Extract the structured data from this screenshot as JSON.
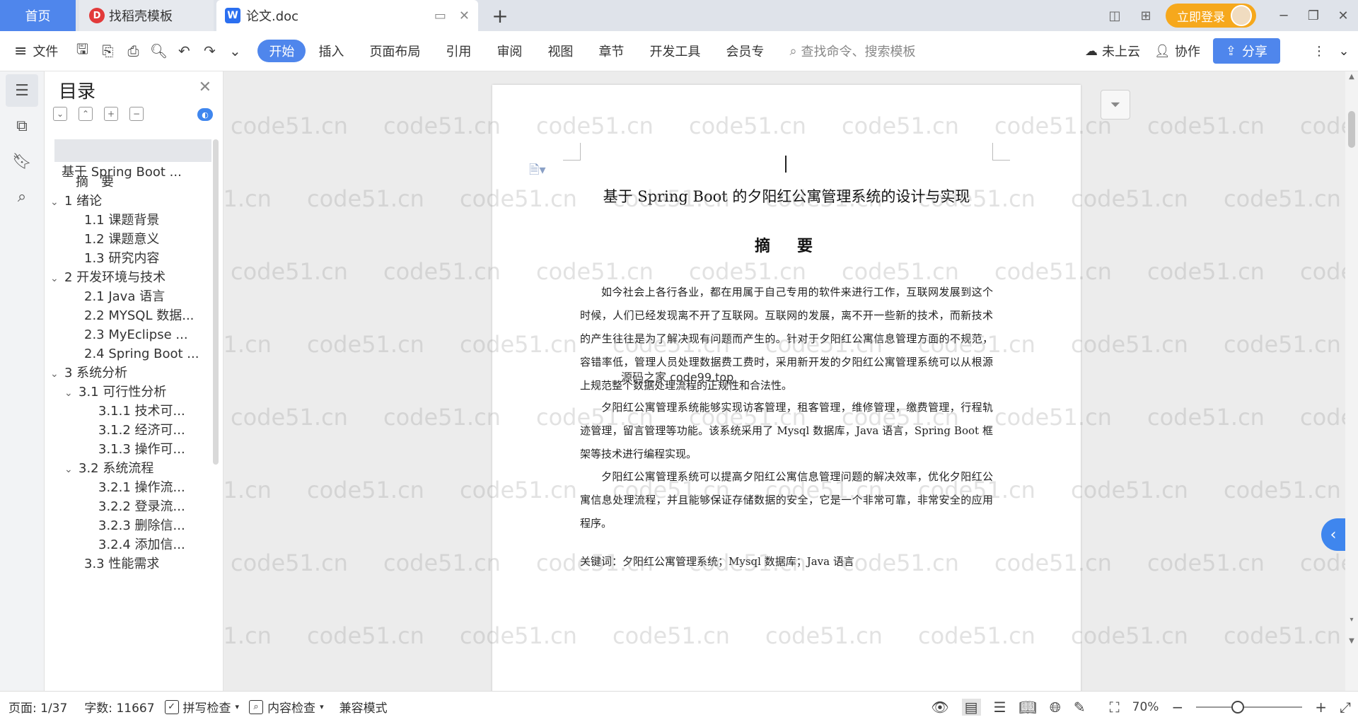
{
  "tabbar": {
    "home_label": "首页",
    "template_tab": "找稻壳模板",
    "template_logo": "D",
    "doc_tab": "论文.doc",
    "doc_logo": "W",
    "login_label": "立即登录"
  },
  "ribbon": {
    "file_label": "文件",
    "tabs": [
      "开始",
      "插入",
      "页面布局",
      "引用",
      "审阅",
      "视图",
      "章节",
      "开发工具",
      "会员专"
    ],
    "active_tab": "开始",
    "search_placeholder": "查找命令、搜索模板",
    "cloud_label": "未上云",
    "collab_label": "协作",
    "share_label": "分享"
  },
  "toc": {
    "title": "目录",
    "selected": "基于 Spring Boot ...",
    "items": [
      {
        "label": "摘　要",
        "caret": ""
      },
      {
        "label": "1  绪论",
        "caret": "v"
      },
      {
        "label": "1.1  课题背景",
        "caret": ""
      },
      {
        "label": "1.2  课题意义",
        "caret": ""
      },
      {
        "label": "1.3  研究内容",
        "caret": ""
      },
      {
        "label": "2  开发环境与技术",
        "caret": "v"
      },
      {
        "label": "2.1 Java 语言",
        "caret": ""
      },
      {
        "label": "2.2 MYSQL 数据...",
        "caret": ""
      },
      {
        "label": "2.3 MyEclipse ...",
        "caret": ""
      },
      {
        "label": "2.4 Spring Boot ...",
        "caret": ""
      },
      {
        "label": "3  系统分析",
        "caret": "v"
      },
      {
        "label": "3.1  可行性分析",
        "caret": "v"
      },
      {
        "label": "3.1.1  技术可...",
        "caret": ""
      },
      {
        "label": "3.1.2  经济可...",
        "caret": ""
      },
      {
        "label": "3.1.3  操作可...",
        "caret": ""
      },
      {
        "label": "3.2  系统流程",
        "caret": "v"
      },
      {
        "label": "3.2.1  操作流...",
        "caret": ""
      },
      {
        "label": "3.2.2  登录流...",
        "caret": ""
      },
      {
        "label": "3.2.3  删除信...",
        "caret": ""
      },
      {
        "label": "3.2.4  添加信...",
        "caret": ""
      },
      {
        "label": "3.3  性能需求",
        "caret": ""
      }
    ]
  },
  "document": {
    "title": "基于 Spring Boot 的夕阳红公寓管理系统的设计与实现",
    "abstract_heading": "摘　要",
    "paragraphs": [
      "如今社会上各行各业，都在用属于自己专用的软件来进行工作，互联网发展到这个时候，人们已经发现离不开了互联网。互联网的发展，离不开一些新的技术，而新技术的产生往往是为了解决现有问题而产生的。针对于夕阳红公寓信息管理方面的不规范，容错率低，管理人员处理数据费工费时，采用新开发的夕阳红公寓管理系统可以从根源上规范整个数据处理流程的正规性和合法性。",
      "夕阳红公寓管理系统能够实现访客管理，租客管理，维修管理，缴费管理，行程轨迹管理，留言管理等功能。该系统采用了 Mysql 数据库，Java 语言，Spring Boot 框架等技术进行编程实现。",
      "夕阳红公寓管理系统可以提高夕阳红公寓信息管理问题的解决效率，优化夕阳红公寓信息处理流程，并且能够保证存储数据的安全，它是一个非常可靠，非常安全的应用程序。"
    ],
    "keywords": "关键词：夕阳红公寓管理系统；Mysql 数据库；Java 语言",
    "overlay_text": "源码之家 code99.top"
  },
  "watermark": "code51.cn",
  "status": {
    "page": "页面: 1/37",
    "words": "字数: 11667",
    "spell_check": "拼写检查",
    "content_check": "内容检查",
    "compat_mode": "兼容模式",
    "zoom": "70%",
    "zoom_level": 0.38
  }
}
